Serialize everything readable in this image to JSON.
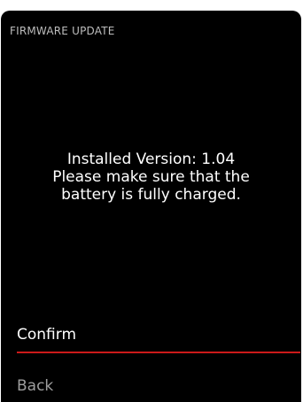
{
  "header": {
    "title": "FIRMWARE UPDATE"
  },
  "message": {
    "lines": [
      "Installed Version: 1.04",
      "Please make sure that the",
      "battery is fully charged."
    ]
  },
  "menu": {
    "confirm_label": "Confirm",
    "back_label": "Back"
  },
  "colors": {
    "background": "#000000",
    "header_text": "#bdbdbd",
    "message_text": "#ffffff",
    "selected_text": "#ffffff",
    "unselected_text": "#9e9e9e",
    "selection_underline": "#cc1a1a"
  }
}
